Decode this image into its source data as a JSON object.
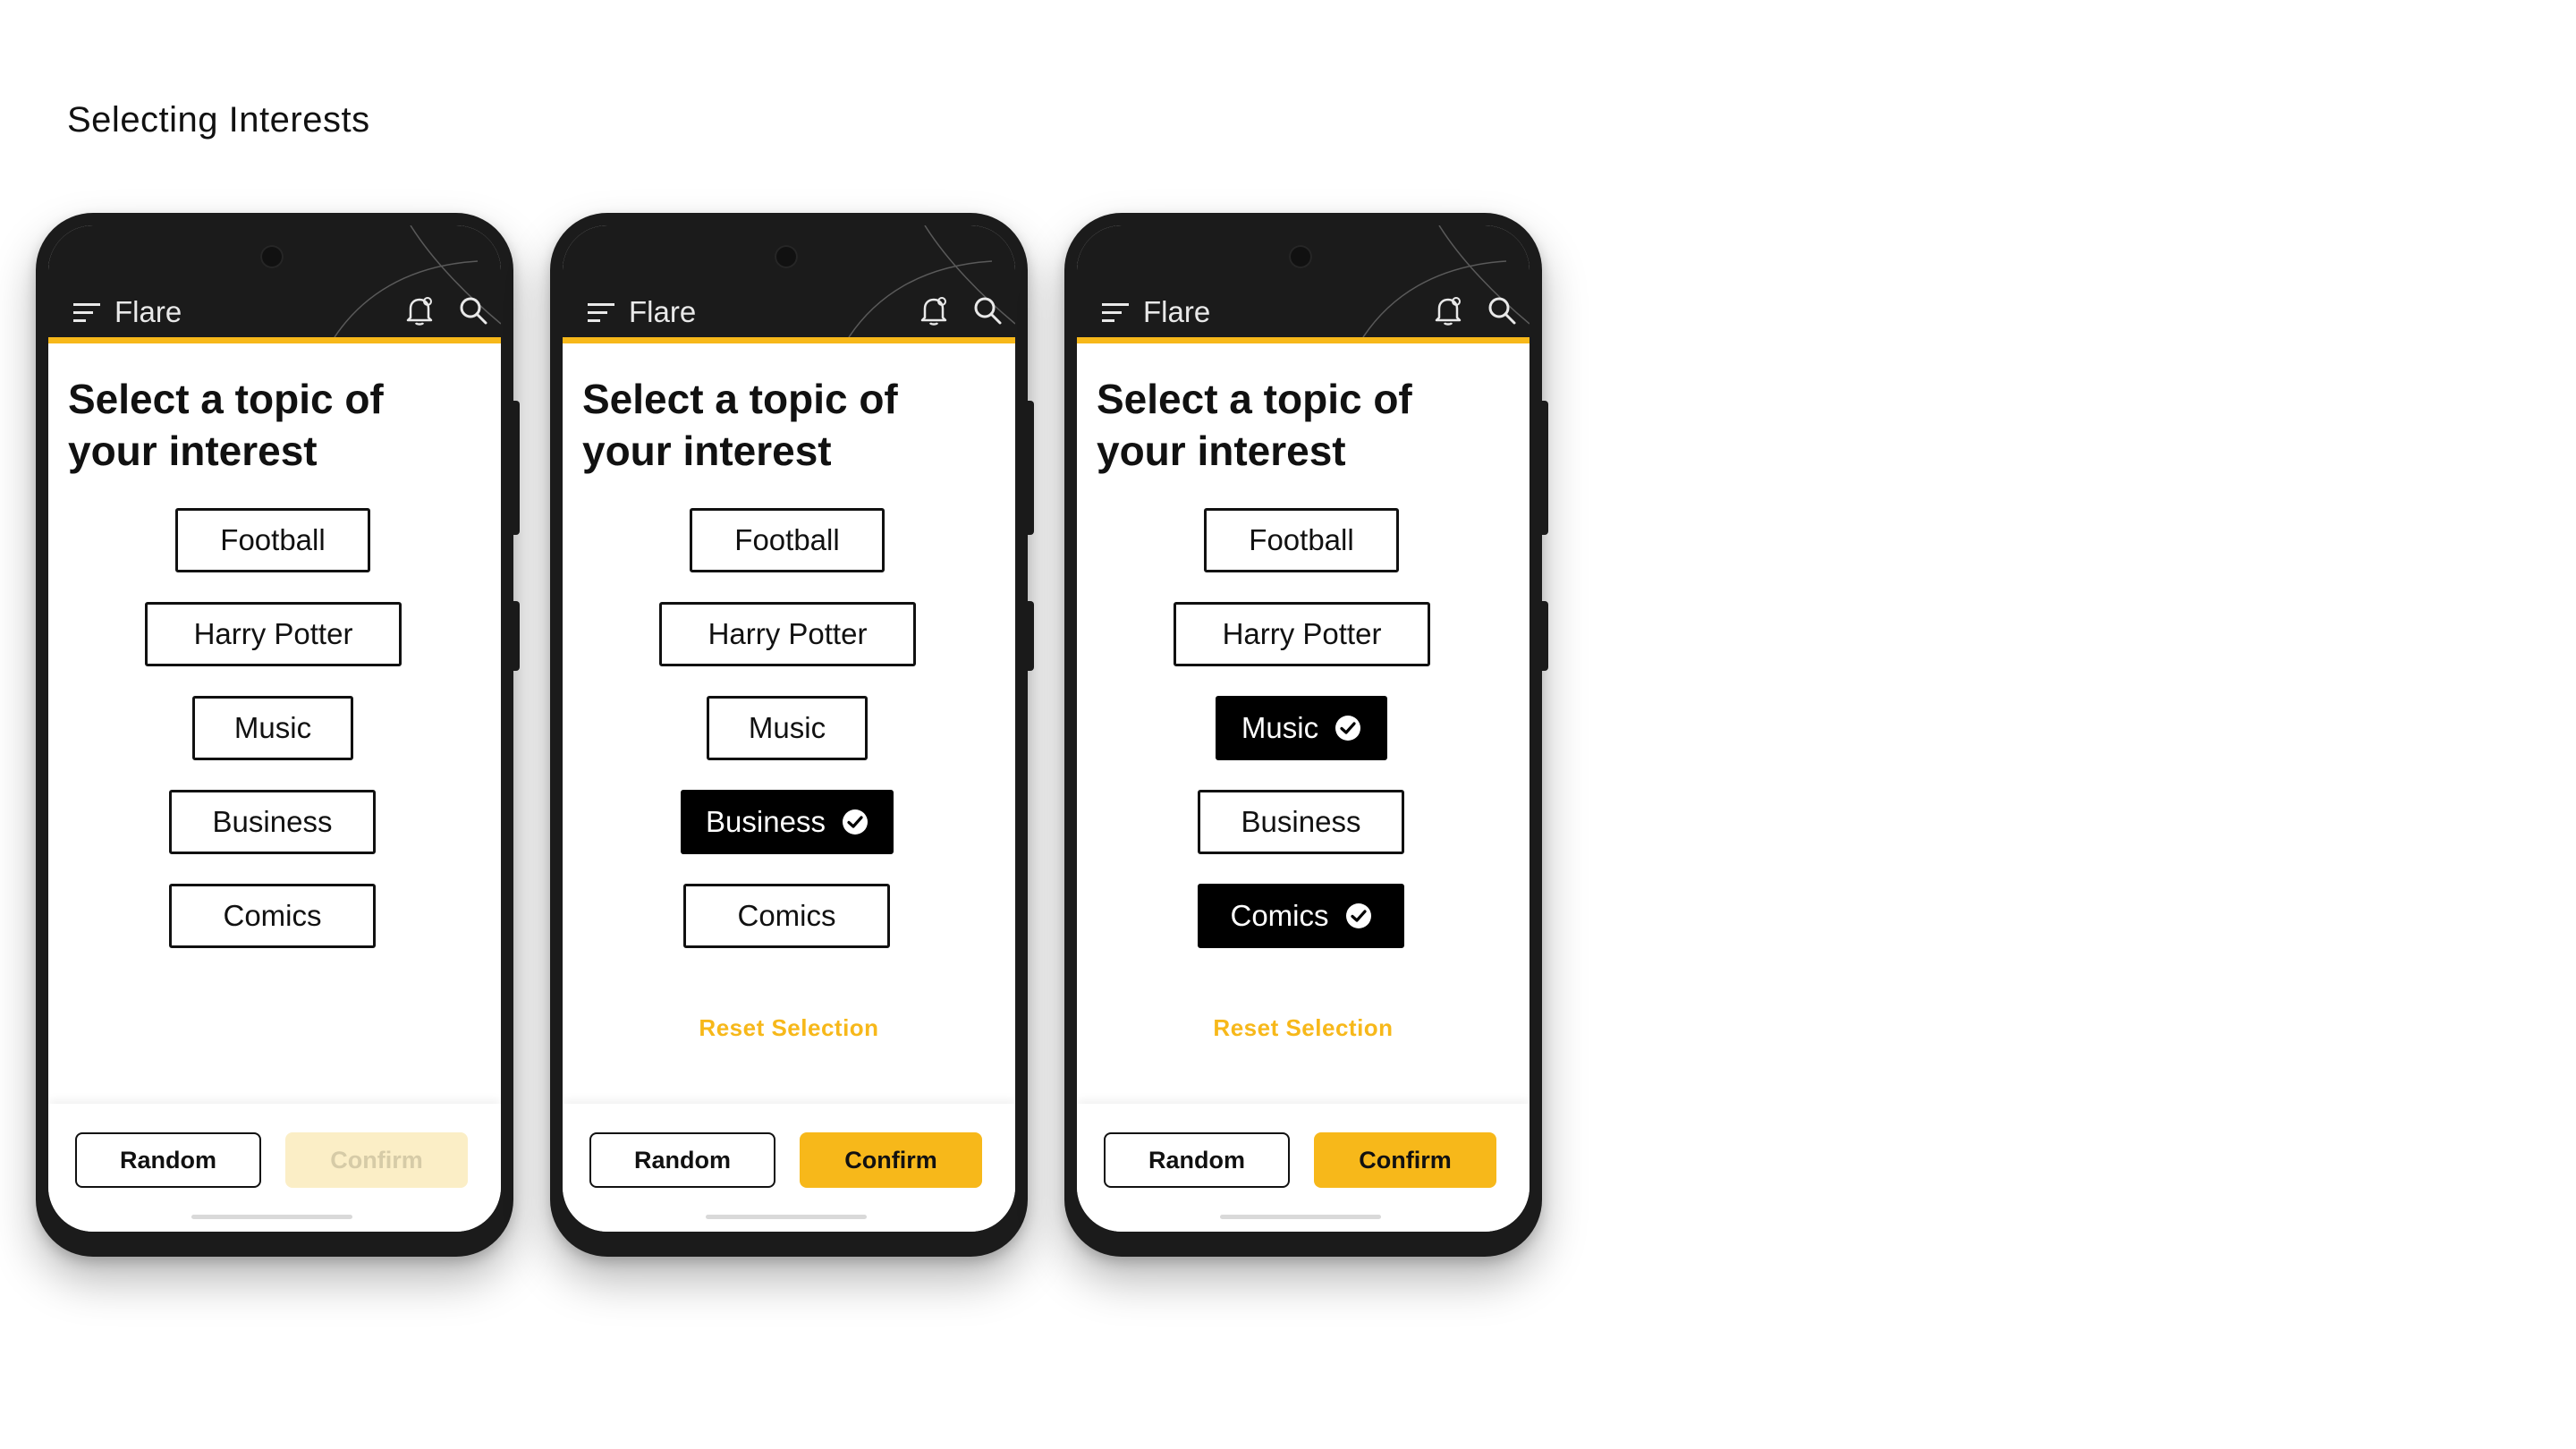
{
  "page": {
    "heading": "Selecting Interests"
  },
  "colors": {
    "accent": "#f7b81a",
    "dark": "#1b1b1b",
    "disabled_confirm": "#fbeec6"
  },
  "icons": [
    "menu-icon",
    "bell-icon",
    "search-icon",
    "check-circle-icon"
  ],
  "phones": [
    {
      "app": {
        "brand": "Flare"
      },
      "title": "Select a topic of your interest",
      "topics": [
        {
          "label": "Football",
          "selected": false
        },
        {
          "label": "Harry Potter",
          "selected": false
        },
        {
          "label": "Music",
          "selected": false
        },
        {
          "label": "Business",
          "selected": false
        },
        {
          "label": "Comics",
          "selected": false
        }
      ],
      "reset_label": "",
      "random_label": "Random",
      "confirm_label": "Confirm",
      "confirm_enabled": false
    },
    {
      "app": {
        "brand": "Flare"
      },
      "title": "Select a topic of your interest",
      "topics": [
        {
          "label": "Football",
          "selected": false
        },
        {
          "label": "Harry Potter",
          "selected": false
        },
        {
          "label": "Music",
          "selected": false
        },
        {
          "label": "Business",
          "selected": true
        },
        {
          "label": "Comics",
          "selected": false
        }
      ],
      "reset_label": "Reset Selection",
      "random_label": "Random",
      "confirm_label": "Confirm",
      "confirm_enabled": true
    },
    {
      "app": {
        "brand": "Flare"
      },
      "title": "Select a topic of your interest",
      "topics": [
        {
          "label": "Football",
          "selected": false
        },
        {
          "label": "Harry Potter",
          "selected": false
        },
        {
          "label": "Music",
          "selected": true
        },
        {
          "label": "Business",
          "selected": false
        },
        {
          "label": "Comics",
          "selected": true
        }
      ],
      "reset_label": "Reset Selection",
      "random_label": "Random",
      "confirm_label": "Confirm",
      "confirm_enabled": true
    }
  ]
}
